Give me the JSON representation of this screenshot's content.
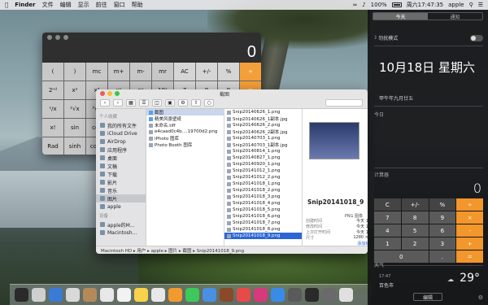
{
  "menubar": {
    "apple": "",
    "app": "Finder",
    "items": [
      "文件",
      "编辑",
      "显示",
      "前往",
      "窗口",
      "帮助"
    ],
    "battery": "100%",
    "clock": "周六17:47:35",
    "user": "apple"
  },
  "calc_big": {
    "display": "0",
    "rows": [
      [
        "(",
        ")",
        "mc",
        "m+",
        "m-",
        "mr",
        "AC",
        "+/-",
        "%",
        "÷"
      ],
      [
        "2ⁿᵈ",
        "x²",
        "x³",
        "xʸ",
        "eˣ",
        "10ˣ",
        "7",
        "8",
        "9",
        "×"
      ],
      [
        "¹/x",
        "²√x",
        "³√x",
        "ʸ√x",
        "ln",
        "log₁₀",
        "4",
        "5",
        "6",
        "-"
      ],
      [
        "x!",
        "sin",
        "cos",
        "tan",
        "e",
        "EE",
        "1",
        "2",
        "3",
        "+"
      ],
      [
        "Rad",
        "sinh",
        "cosh",
        "tanh",
        "π",
        "Rand",
        "0",
        "",
        ".",
        "="
      ]
    ]
  },
  "finder": {
    "title": "截图",
    "sidebar": {
      "favorites_header": "个人收藏",
      "favorites": [
        "我的所有文件",
        "iCloud Drive",
        "AirDrop",
        "应用程序",
        "桌面",
        "文稿",
        "下载",
        "影片",
        "音乐",
        "图片",
        "apple"
      ],
      "devices_header": "设备",
      "devices": [
        "apple的M...",
        "Macintosh..."
      ]
    },
    "col1": [
      "截图",
      "精美风景壁纸",
      "未命名.tiff",
      "e4caad0c4b....19700d2.png",
      "iPhoto 图库",
      "Photo Booth 图库"
    ],
    "col2": [
      "Snip20140626_1.png",
      "Snip20140626_1副本.jpg",
      "Snip20140626_2.png",
      "Snip20140626_2副本.jpg",
      "Snip20140703_1.png",
      "Snip20140703_1副本.jpg",
      "Snip20140814_1.png",
      "Snip20140827_1.png",
      "Snip20140920_1.png",
      "Snip20141012_1.png",
      "Snip20141012_2.png",
      "Snip20141018_1.png",
      "Snip20141018_2.png",
      "Snip20141018_3.png",
      "Snip20141018_4.png",
      "Snip20141018_5.png",
      "Snip20141018_6.png",
      "Snip20141018_7.png",
      "Snip20141018_8.png",
      "Snip20141018_9.png"
    ],
    "preview": {
      "name": "Snip20141018_9",
      "type": "PNG 图像",
      "meta": [
        {
          "k": "创建时间",
          "v": "今天 17:43"
        },
        {
          "k": "修改时间",
          "v": "今天 17:43"
        },
        {
          "k": "上次打开时间",
          "v": "今天 17:43"
        },
        {
          "k": "尺寸",
          "v": "1280 × 800"
        }
      ],
      "more": "添加标记..."
    },
    "path": "Macintosh HD ▸ 用户 ▸ apple ▸ 图片 ▸ 截图 ▸ Snip20141018_9.png"
  },
  "dock": {
    "colors": [
      "#2a2a2a",
      "#cfcfcf",
      "#3a7bd5",
      "#d9d9d9",
      "#b58a5a",
      "#e8e8e8",
      "#f2f2f2",
      "#f7d24a",
      "#e8e8e8",
      "#f29a2e",
      "#3cc85a",
      "#4a90e2",
      "#8a4a2a",
      "#e84a4a",
      "#d63a7a",
      "#3a8be8",
      "#5a5a5a",
      "#2a2a2a",
      "#6a6a6a",
      "#e0e0e0"
    ]
  },
  "nc": {
    "tab_today": "今天",
    "tab_notifications": "通知",
    "dnd": "勿扰模式",
    "date": "10月18日 星期六",
    "lunar": "甲午年九月廿五",
    "section_today": "今日",
    "section_calc": "计算器",
    "calc_display": "0",
    "calc_keys": [
      {
        "t": "C",
        "c": "fn"
      },
      {
        "t": "+/-",
        "c": "fn"
      },
      {
        "t": "%",
        "c": "fn"
      },
      {
        "t": "÷",
        "c": "op"
      },
      {
        "t": "7",
        "c": ""
      },
      {
        "t": "8",
        "c": ""
      },
      {
        "t": "9",
        "c": ""
      },
      {
        "t": "×",
        "c": "op"
      },
      {
        "t": "4",
        "c": ""
      },
      {
        "t": "5",
        "c": ""
      },
      {
        "t": "6",
        "c": ""
      },
      {
        "t": "-",
        "c": "op"
      },
      {
        "t": "1",
        "c": ""
      },
      {
        "t": "2",
        "c": ""
      },
      {
        "t": "3",
        "c": ""
      },
      {
        "t": "+",
        "c": "op"
      },
      {
        "t": "0",
        "c": "zero"
      },
      {
        "t": ".",
        "c": ""
      },
      {
        "t": "=",
        "c": "op"
      }
    ],
    "section_weather": "天气",
    "weather_time": "17:47",
    "weather_city": "百色市",
    "weather_temp": "29°",
    "edit": "编辑"
  }
}
